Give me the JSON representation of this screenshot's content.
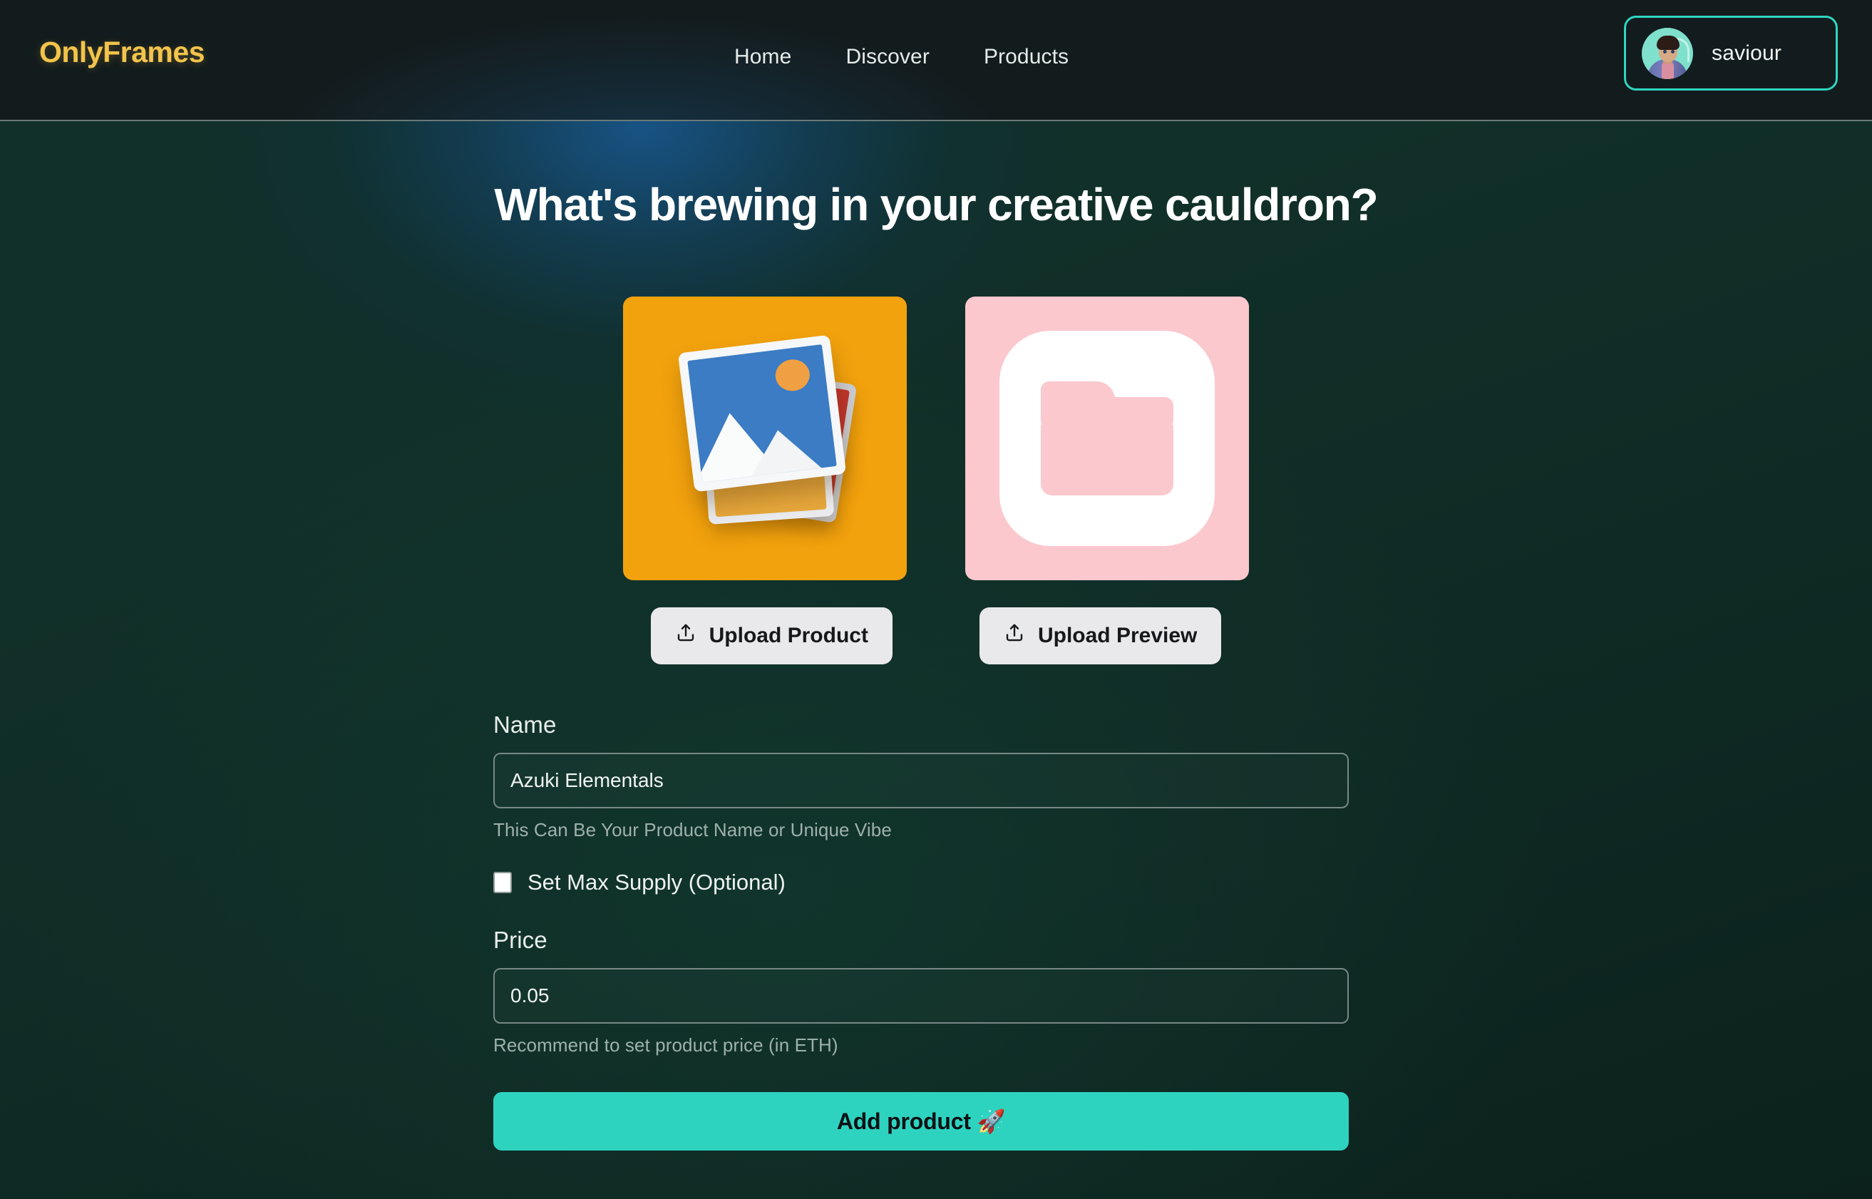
{
  "header": {
    "brand": "OnlyFrames",
    "nav": [
      {
        "label": "Home"
      },
      {
        "label": "Discover"
      },
      {
        "label": "Products"
      }
    ],
    "user": {
      "name": "saviour",
      "avatar_icon": "user-avatar-illustration",
      "border_color": "#2FD6BE"
    }
  },
  "main": {
    "title": "What's brewing in your creative cauldron?",
    "tiles": [
      {
        "name": "product-image-tile",
        "icon": "photo-stack-icon",
        "background_color": "#F2A20D"
      },
      {
        "name": "preview-image-tile",
        "icon": "folder-icon",
        "background_color": "#FBC8CE"
      }
    ],
    "upload_buttons": [
      {
        "label": "Upload Product",
        "icon": "upload-icon"
      },
      {
        "label": "Upload Preview",
        "icon": "upload-icon"
      }
    ],
    "form": {
      "name_field": {
        "label": "Name",
        "value": "Azuki Elementals",
        "placeholder": "Azuki Elementals",
        "helper": "This Can Be Your Product Name or Unique Vibe"
      },
      "max_supply": {
        "label": "Set Max Supply (Optional)",
        "checked": false
      },
      "price_field": {
        "label": "Price",
        "value": "0.05",
        "placeholder": "0.05",
        "helper": "Recommend to set product price (in ETH)"
      },
      "submit": {
        "label": "Add product 🚀",
        "color": "#2ED3C0"
      }
    }
  },
  "theme": {
    "background": "#0E2721",
    "header_background": "#131C1D",
    "brand_color": "#F2C44B",
    "accent_color": "#2ED3C0",
    "glow_color": "#18568C"
  }
}
